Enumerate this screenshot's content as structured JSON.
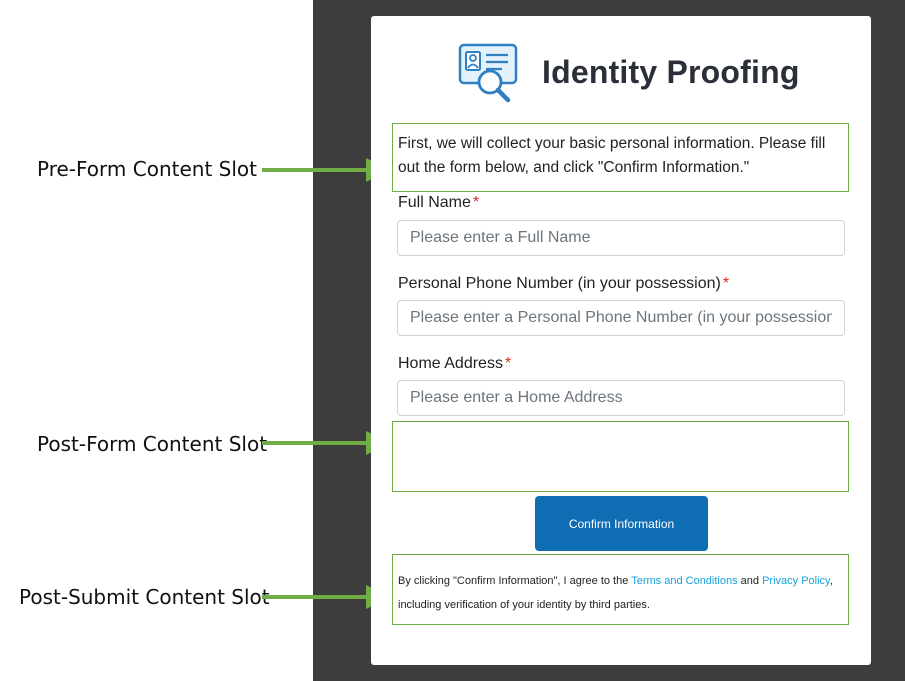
{
  "annotations": {
    "pre_form": "Pre-Form Content Slot",
    "post_form": "Post-Form Content Slot",
    "post_submit": "Post-Submit Content Slot"
  },
  "colors": {
    "slot_border": "#70ad47",
    "arrow": "#70ad47",
    "button": "#0f6db4",
    "link": "#17a2d8",
    "required": "#e0281d",
    "backdrop": "#3d3d3d"
  },
  "header": {
    "title": "Identity Proofing",
    "logo_icon": "id-card-search-icon"
  },
  "pre_form_text": "First, we will collect your basic personal information. Please fill out the form below, and click \"Confirm Information.\"",
  "form": {
    "fields": [
      {
        "label": "Full Name",
        "required_mark": "*",
        "placeholder": "Please enter a Full Name",
        "value": ""
      },
      {
        "label": "Personal Phone Number (in your possession)",
        "required_mark": "*",
        "placeholder": "Please enter a Personal Phone Number (in your possession)",
        "value": ""
      },
      {
        "label": "Home Address",
        "required_mark": "*",
        "placeholder": "Please enter a Home Address",
        "value": ""
      }
    ],
    "submit_label": "Confirm Information"
  },
  "terms": {
    "prefix": "By clicking \"Confirm Information\", I agree to the ",
    "terms_link": "Terms and Conditions",
    "middle": " and ",
    "privacy_link": "Privacy Policy",
    "suffix": ", including verification of your identity by third parties."
  }
}
